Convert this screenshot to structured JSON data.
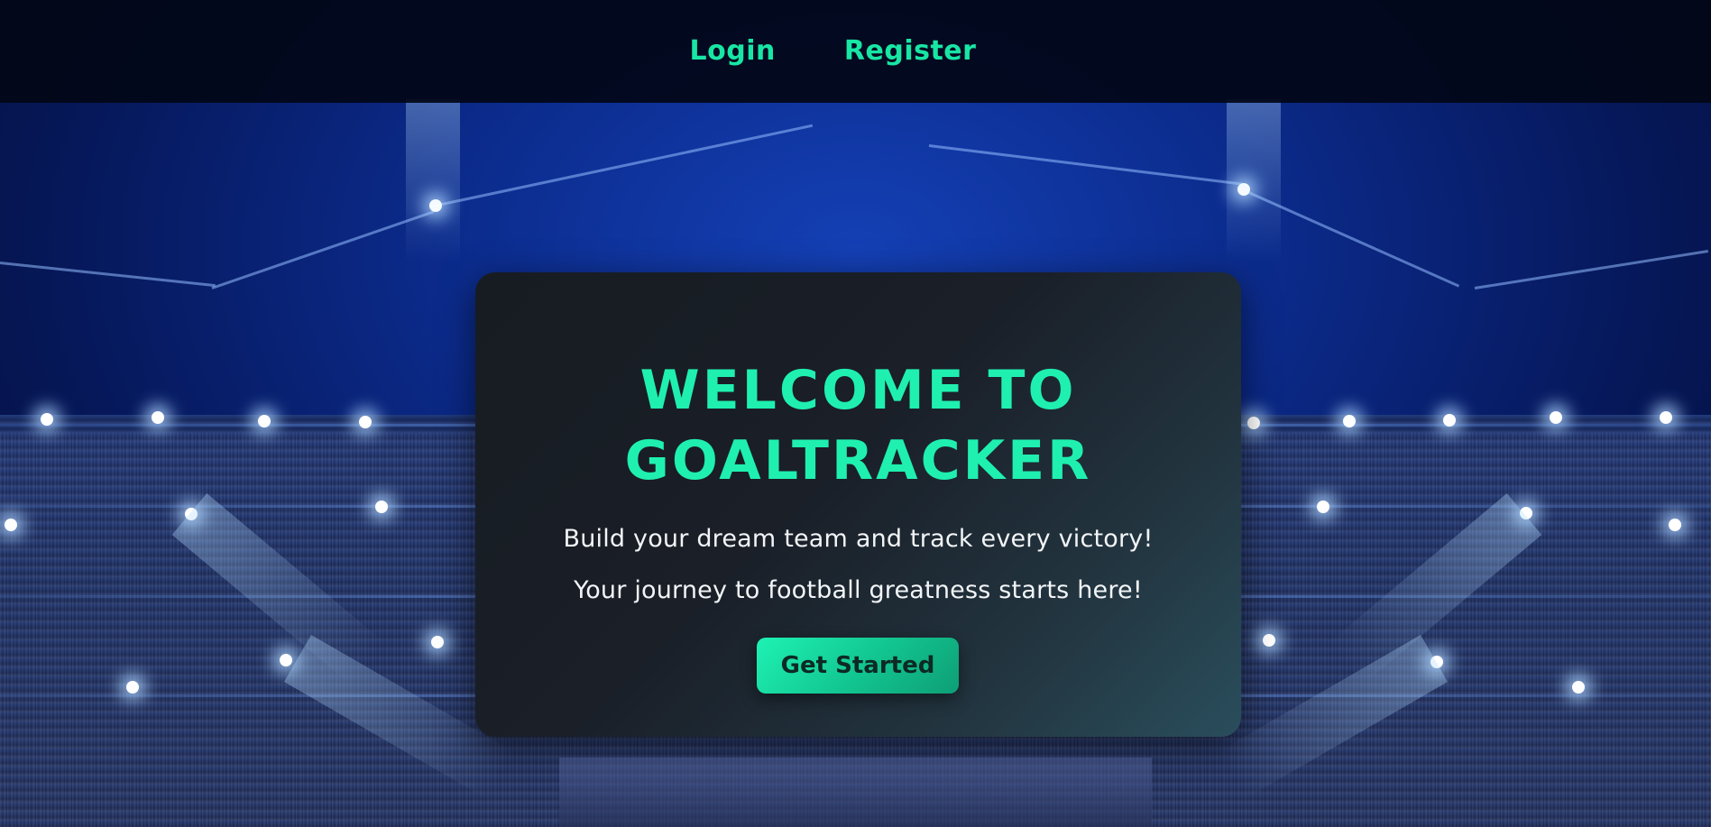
{
  "nav": {
    "login_label": "Login",
    "register_label": "Register"
  },
  "hero": {
    "title_line1": "WELCOME TO",
    "title_line2": "GOALTRACKER",
    "tagline1": "Build your dream team and track every victory!",
    "tagline2": "Your journey to football greatness starts here!",
    "cta_label": "Get Started"
  },
  "colors": {
    "accent": "#1ff0b0",
    "header_bg": "#02061a",
    "card_bg": "#1a1f28"
  }
}
